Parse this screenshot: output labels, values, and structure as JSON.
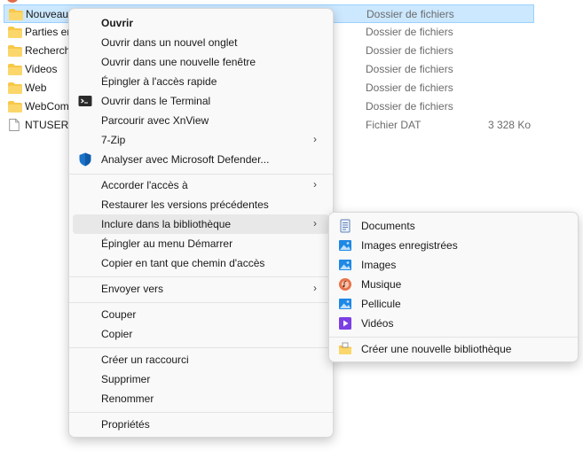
{
  "file_list": {
    "rows": [
      {
        "name": "Nouveau",
        "type": "Dossier de fichiers",
        "size": "",
        "icon": "folder-icon",
        "selected": true
      },
      {
        "name": "Parties er",
        "type": "Dossier de fichiers",
        "size": "",
        "icon": "folder-icon"
      },
      {
        "name": "Recherch",
        "type": "Dossier de fichiers",
        "size": "",
        "icon": "folder-icon"
      },
      {
        "name": "Videos",
        "type": "Dossier de fichiers",
        "size": "",
        "icon": "folder-icon"
      },
      {
        "name": "Web",
        "type": "Dossier de fichiers",
        "size": "",
        "icon": "folder-icon"
      },
      {
        "name": "WebCom",
        "type": "Dossier de fichiers",
        "size": "",
        "icon": "folder-icon"
      },
      {
        "name": "NTUSER.D",
        "type": "Fichier DAT",
        "size": "3 328 Ko",
        "icon": "file-icon"
      }
    ]
  },
  "context_menu": {
    "open": "Ouvrir",
    "open_new_tab": "Ouvrir dans un nouvel onglet",
    "open_new_window": "Ouvrir dans une nouvelle fenêtre",
    "pin_quick_access": "Épingler à l'accès rapide",
    "open_terminal": "Ouvrir dans le Terminal",
    "browse_xnview": "Parcourir avec XnView",
    "seven_zip": "7-Zip",
    "scan_defender": "Analyser avec Microsoft Defender...",
    "give_access": "Accorder l'accès à",
    "restore_versions": "Restaurer les versions précédentes",
    "include_library": "Inclure dans la bibliothèque",
    "pin_start": "Épingler au menu Démarrer",
    "copy_path": "Copier en tant que chemin d'accès",
    "send_to": "Envoyer vers",
    "cut": "Couper",
    "copy": "Copier",
    "create_shortcut": "Créer un raccourci",
    "delete": "Supprimer",
    "rename": "Renommer",
    "properties": "Propriétés",
    "submenu_arrow": "›"
  },
  "library_submenu": {
    "documents": "Documents",
    "saved_pictures": "Images enregistrées",
    "pictures": "Images",
    "music": "Musique",
    "camera_roll": "Pellicule",
    "videos": "Vidéos",
    "new_library": "Créer une nouvelle bibliothèque"
  },
  "colors": {
    "selection_bg": "#cce8ff",
    "folder": "#f8c84a",
    "defender_blue": "#1a73c8",
    "library_blue": "#1e88e5",
    "music_orange": "#e8734a",
    "video_purple": "#7b3fe4"
  }
}
